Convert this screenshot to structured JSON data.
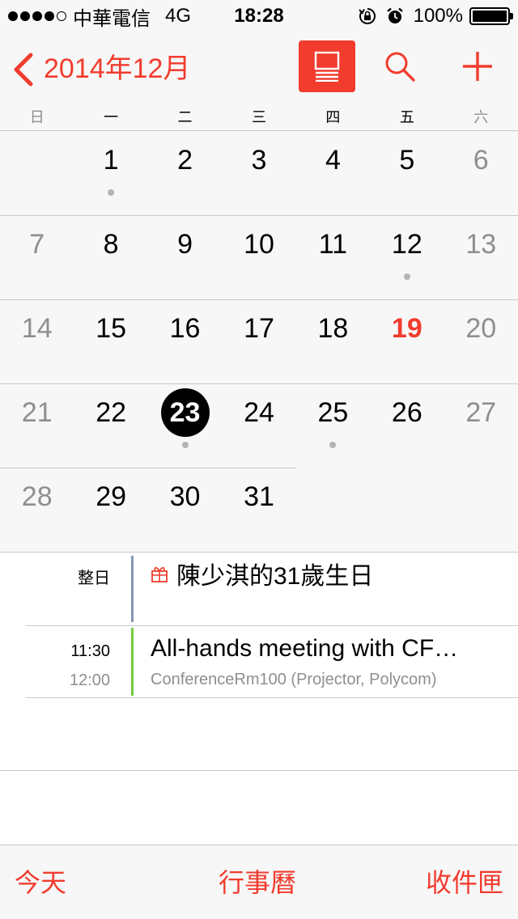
{
  "status_bar": {
    "carrier": "中華電信",
    "network": "4G",
    "time": "18:28",
    "battery": "100%",
    "battery_level": 1.0,
    "icons": [
      "signal-dots",
      "rotation-lock-icon",
      "alarm-icon",
      "battery-icon"
    ]
  },
  "nav": {
    "back_icon": "chevron-left-icon",
    "title": "2014年12月",
    "list_toggle_icon": "list-view-icon",
    "search_icon": "search-icon",
    "add_icon": "plus-icon"
  },
  "colors": {
    "accent": "#f13c2e",
    "weekend_text": "#8e8e93",
    "dot": "#b4b4b4",
    "all_day_bar": "#8496b5",
    "event_bar": "#75c940",
    "background": "#f7f7f7"
  },
  "weekdays": [
    "日",
    "一",
    "二",
    "三",
    "四",
    "五",
    "六"
  ],
  "weeks": [
    [
      null,
      {
        "n": "1",
        "dot": true
      },
      {
        "n": "2"
      },
      {
        "n": "3"
      },
      {
        "n": "4"
      },
      {
        "n": "5"
      },
      {
        "n": "6"
      }
    ],
    [
      {
        "n": "7"
      },
      {
        "n": "8"
      },
      {
        "n": "9"
      },
      {
        "n": "10"
      },
      {
        "n": "11"
      },
      {
        "n": "12",
        "dot": true
      },
      {
        "n": "13"
      }
    ],
    [
      {
        "n": "14"
      },
      {
        "n": "15"
      },
      {
        "n": "16"
      },
      {
        "n": "17"
      },
      {
        "n": "18"
      },
      {
        "n": "19",
        "today": true
      },
      {
        "n": "20"
      }
    ],
    [
      {
        "n": "21"
      },
      {
        "n": "22"
      },
      {
        "n": "23",
        "selected": true,
        "dot": true
      },
      {
        "n": "24"
      },
      {
        "n": "25",
        "dot": true
      },
      {
        "n": "26"
      },
      {
        "n": "27"
      }
    ],
    [
      {
        "n": "28"
      },
      {
        "n": "29"
      },
      {
        "n": "30"
      },
      {
        "n": "31"
      },
      null,
      null,
      null
    ]
  ],
  "events": {
    "all_day": {
      "label": "整日",
      "icon": "gift-icon",
      "title": "陳少淇的31歲生日"
    },
    "meeting": {
      "start": "11:30",
      "end": "12:00",
      "title": "All-hands meeting with CF…",
      "location": "ConferenceRm100 (Projector, Polycom)"
    }
  },
  "toolbar": {
    "today": "今天",
    "calendars": "行事曆",
    "inbox": "收件匣"
  }
}
